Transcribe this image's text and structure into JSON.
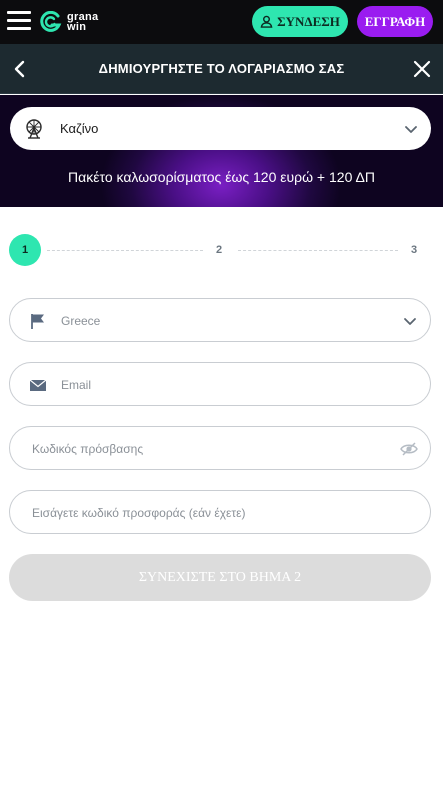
{
  "topbar": {
    "logo_line1": "grana",
    "logo_line2": "win",
    "login_label": "ΣΥΝΔΕΣΗ",
    "register_label": "ΕΓΓΡΑΦΗ"
  },
  "header": {
    "title": "ΔΗΜΙΟΥΡΓΗΣΤΕ ΤΟ ΛΟΓΑΡΙΑΣΜΟ ΣΑΣ"
  },
  "promo": {
    "selected_product": "Καζίνο",
    "welcome_text": "Πακέτο καλωσορίσματος έως 120 ευρώ + 120 ΔΠ"
  },
  "stepper": {
    "current": 1,
    "steps": [
      "1",
      "2",
      "3"
    ]
  },
  "form": {
    "country_value": "Greece",
    "email_placeholder": "Email",
    "password_placeholder": "Κωδικός πρόσβασης",
    "promo_code_placeholder": "Εισάγετε κωδικό προσφοράς (εάν έχετε)",
    "continue_label": "ΣΥΝΕΧΙΣΤΕ ΣΤΟ ΒΗΜΑ 2"
  },
  "colors": {
    "accent_green": "#2ee6b0",
    "accent_purple": "#9a1cf0",
    "header_bg": "#1d2a30",
    "disabled_button": "#dcdcdc"
  },
  "icons": [
    "hamburger-icon",
    "grana-logo-icon",
    "user-icon",
    "back-arrow-icon",
    "close-icon",
    "ferris-wheel-icon",
    "chevron-down-icon",
    "flag-icon",
    "envelope-icon",
    "eye-icon"
  ]
}
